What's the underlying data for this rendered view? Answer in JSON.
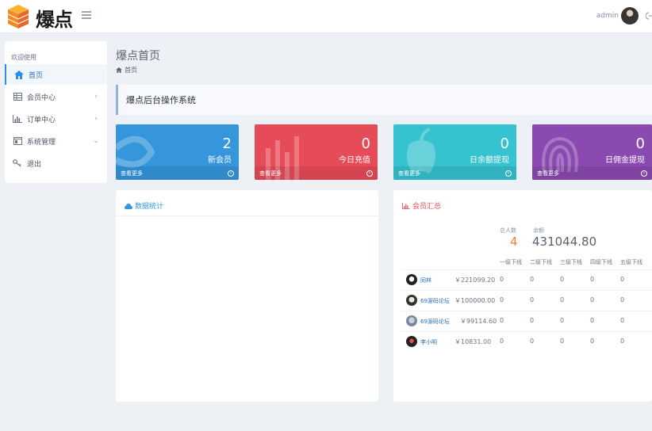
{
  "header": {
    "brand": "爆点",
    "user": "admin"
  },
  "sidebar": {
    "welcome": "欢迎使用",
    "items": [
      {
        "label": "首页",
        "icon": "home-icon"
      },
      {
        "label": "会员中心",
        "icon": "table-icon"
      },
      {
        "label": "订单中心",
        "icon": "bar-chart-icon"
      },
      {
        "label": "系统管理",
        "icon": "window-icon"
      },
      {
        "label": "退出",
        "icon": "key-icon"
      }
    ]
  },
  "page": {
    "title": "爆点首页",
    "breadcrumb": "首页",
    "notice": "爆点后台操作系统"
  },
  "stats": [
    {
      "value": "2",
      "label": "新会员",
      "more": "查看更多",
      "color": "#3596db"
    },
    {
      "value": "0",
      "label": "今日充值",
      "more": "查看更多",
      "color": "#e64b58"
    },
    {
      "value": "0",
      "label": "日余额提现",
      "more": "查看更多",
      "color": "#35c3cf"
    },
    {
      "value": "0",
      "label": "日佣金提现",
      "more": "查看更多",
      "color": "#8a4ab1"
    }
  ],
  "panels": {
    "data_title": "数据统计",
    "member_title": "会员汇总"
  },
  "summary": {
    "total_label": "总人数",
    "total_value": "4",
    "balance_label": "余额",
    "balance_value": "431044.80"
  },
  "table": {
    "headers": [
      "一级下线",
      "二级下线",
      "三级下线",
      "四级下线",
      "五级下线"
    ],
    "rows": [
      {
        "name": "同林",
        "amount": "￥221099.20",
        "levels": [
          "0",
          "0",
          "0",
          "0",
          "0"
        ]
      },
      {
        "name": "69源码论坛",
        "amount": "￥100000.00",
        "levels": [
          "0",
          "0",
          "0",
          "0",
          "0"
        ]
      },
      {
        "name": "69源码论坛",
        "amount": "￥99114.60",
        "levels": [
          "0",
          "0",
          "0",
          "0",
          "0"
        ]
      },
      {
        "name": "李小明",
        "amount": "￥10831.00",
        "levels": [
          "0",
          "0",
          "0",
          "0",
          "0"
        ]
      }
    ]
  },
  "colors": {
    "accent": "#2d8cf0",
    "orange": "#f07e2c",
    "chart_red": "#e64b58"
  }
}
